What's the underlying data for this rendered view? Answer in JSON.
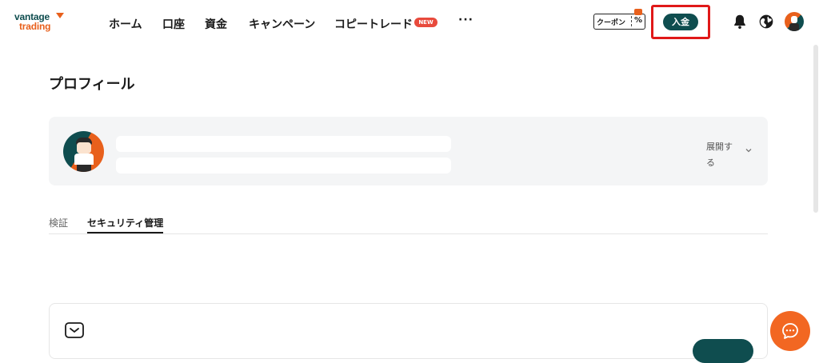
{
  "brand": {
    "line1": "vantage",
    "line2": "trading"
  },
  "nav": {
    "items": [
      "ホーム",
      "口座",
      "資金",
      "キャンペーン",
      "コピートレード"
    ],
    "new_badge": "NEW",
    "more": "···"
  },
  "header": {
    "coupon_label": "クーポン",
    "coupon_symbol": "%",
    "deposit_label": "入金"
  },
  "page": {
    "title": "プロフィール"
  },
  "profile": {
    "expand_label": "展開する"
  },
  "tabs": [
    "検証",
    "セキュリティ管理"
  ],
  "icons": {
    "bell": "bell-icon",
    "globe": "globe-icon",
    "mail": "mail-icon",
    "chat": "chat-icon",
    "chevron": "chevron-down-icon"
  },
  "colors": {
    "brand_teal": "#0f4d4f",
    "brand_orange": "#e8601c",
    "highlight_red": "#e01818",
    "badge_red": "#e84a3c",
    "chat_orange": "#f26722"
  }
}
